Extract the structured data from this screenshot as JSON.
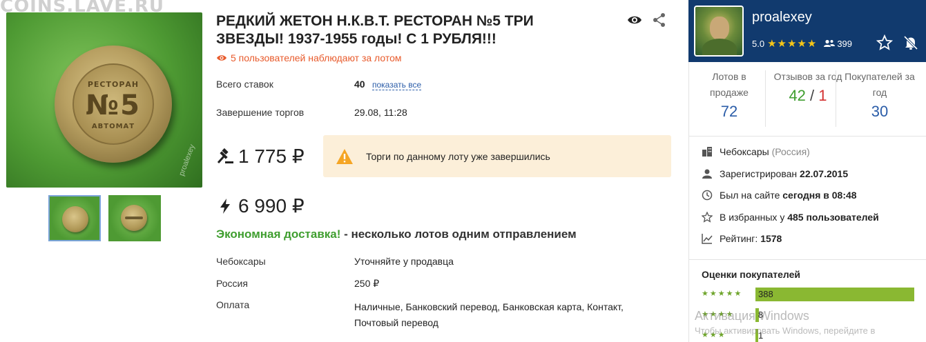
{
  "site_watermark": "COINS.LAVE.RU",
  "gallery": {
    "photo_watermark": "proalexey",
    "coin_text_top": "РЕСТОРАН",
    "coin_text_mid": "№5",
    "coin_text_bottom": "АВТОМАТ"
  },
  "lot": {
    "title": "РЕДКИЙ ЖЕТОН Н.К.В.Т. РЕСТОРАН №5 ТРИ ЗВЕЗДЫ! 1937-1955 годы! С 1 РУБЛЯ!!!",
    "watchers": "5 пользователей наблюдают за лотом",
    "bids_label": "Всего ставок",
    "bids_count": "40",
    "show_all": "показать все",
    "end_label": "Завершение торгов",
    "end_value": "29.08, 11:28",
    "current_price": "1 775 ₽",
    "ended_notice": "Торги по данному лоту уже завершились",
    "buy_now_price": "6 990 ₽",
    "delivery_highlight": "Экономная доставка!",
    "delivery_rest": " - несколько лотов одним отправлением",
    "details": [
      {
        "label": "Чебоксары",
        "value": "Уточняйте у продавца"
      },
      {
        "label": "Россия",
        "value": "250 ₽"
      },
      {
        "label": "Оплата",
        "value": "Наличные, Банковский перевод, Банковская карта, Контакт, Почтовый перевод"
      }
    ]
  },
  "seller": {
    "name": "proalexey",
    "rating": "5.0",
    "stars": "★★★★★",
    "followers": "399",
    "stats": [
      {
        "label": "Лотов в продаже",
        "value": "72"
      },
      {
        "label": "Отзывов за год",
        "value_positive": "42",
        "separator": "/",
        "value_negative": "1"
      },
      {
        "label": "Покупателей за год",
        "value": "30"
      }
    ],
    "city": "Чебоксары",
    "country": "(Россия)",
    "registered_label": "Зарегистрирован",
    "registered_date": "22.07.2015",
    "last_seen_label": "Был на сайте",
    "last_seen_value": "сегодня в 08:48",
    "favorites_label": "В избранных у",
    "favorites_value": "485 пользователей",
    "rating_label": "Рейтинг:",
    "rating_value": "1578",
    "ratings_title": "Оценки покупателей",
    "rating_rows": [
      {
        "stars": "★★★★★",
        "count": "388",
        "fraction": 1.0
      },
      {
        "stars": "★★★★",
        "count": "8",
        "fraction": 0.021
      },
      {
        "stars": "★★★",
        "count": "1",
        "fraction": 0.003
      }
    ]
  },
  "os_watermark": {
    "line1": "Активация Windows",
    "line2": "Чтобы активировать Windows, перейдите в"
  }
}
